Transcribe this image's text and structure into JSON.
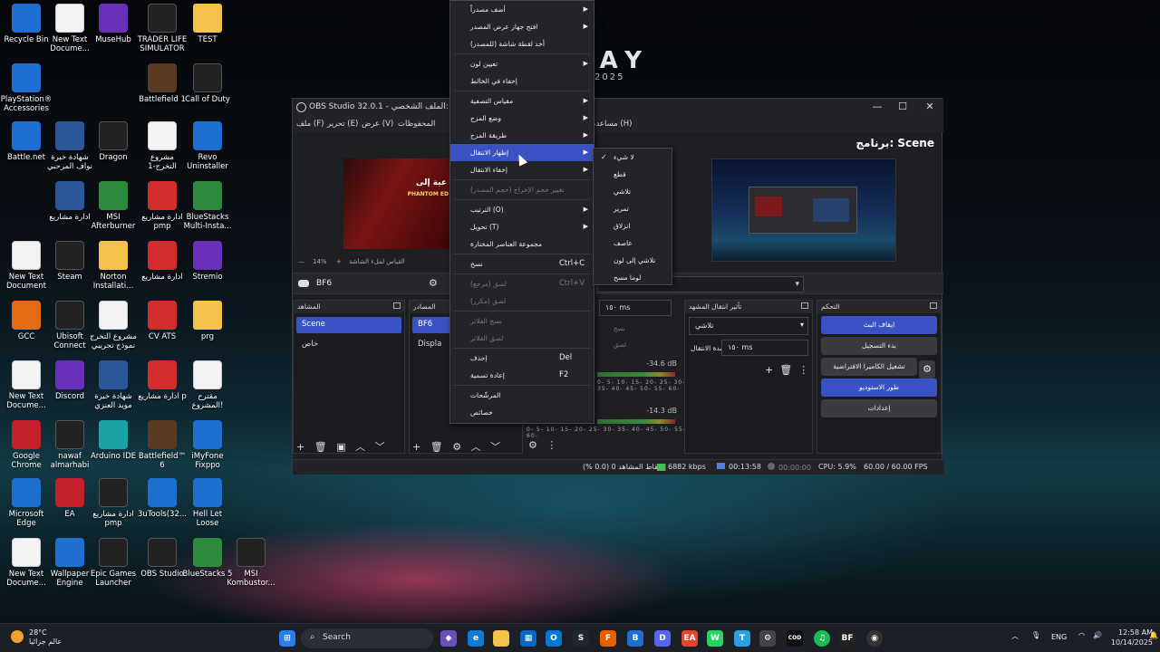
{
  "wallpaper": {
    "text": "DAY",
    "year": "2025"
  },
  "desktop_icons": [
    {
      "label": "Recycle Bin",
      "icon": "recycle-bin-icon"
    },
    {
      "label": "New Text Docume...",
      "icon": "text-doc-icon"
    },
    {
      "label": "MuseHub",
      "icon": "musehub-icon"
    },
    {
      "label": "TRADER LIFE SIMULATOR",
      "icon": "game-icon"
    },
    {
      "label": "TEST",
      "icon": "folder-icon"
    },
    {
      "label": "PlayStation® Accessories",
      "icon": "playstation-icon"
    },
    {
      "label": "Battlefield 1",
      "icon": "game-icon"
    },
    {
      "label": "Call of Duty",
      "icon": "cod-icon"
    },
    {
      "label": "Battle.net",
      "icon": "battlenet-icon"
    },
    {
      "label": "شهادة خبرة نواف المرحبي",
      "icon": "word-icon"
    },
    {
      "label": "Dragon",
      "icon": "dragon-icon"
    },
    {
      "label": "مشروع التخرج-1",
      "icon": "doc-icon"
    },
    {
      "label": "Revo Uninstaller",
      "icon": "revo-icon"
    },
    {
      "label": "ادارة مشاريع",
      "icon": "word-icon"
    },
    {
      "label": "MSI Afterburner",
      "icon": "msi-icon"
    },
    {
      "label": "ادارة مشاريع pmp",
      "icon": "pdf-icon"
    },
    {
      "label": "BlueStacks Multi-Insta...",
      "icon": "bluestacks-icon"
    },
    {
      "label": "New Text Document",
      "icon": "text-doc-icon"
    },
    {
      "label": "Steam",
      "icon": "steam-icon"
    },
    {
      "label": "Norton Installati...",
      "icon": "folder-icon"
    },
    {
      "label": "ادارة مشاريع",
      "icon": "pdf-icon"
    },
    {
      "label": "Stremio",
      "icon": "stremio-icon"
    },
    {
      "label": "GCC",
      "icon": "gcc-icon"
    },
    {
      "label": "Ubisoft Connect",
      "icon": "ubisoft-icon"
    },
    {
      "label": "مشروع التخرج نموذج تجريبي",
      "icon": "doc-icon"
    },
    {
      "label": "CV ATS",
      "icon": "pdf-icon"
    },
    {
      "label": "prg",
      "icon": "folder-icon"
    },
    {
      "label": "New Text Docume...",
      "icon": "text-doc-icon"
    },
    {
      "label": "Discord",
      "icon": "discord-icon"
    },
    {
      "label": "شهادة خبرة مويد العنزي",
      "icon": "word-icon"
    },
    {
      "label": "ادارة مشاريع p",
      "icon": "pdf-icon"
    },
    {
      "label": "مقترح المشروع!",
      "icon": "doc-icon"
    },
    {
      "label": "Google Chrome",
      "icon": "chrome-icon"
    },
    {
      "label": "nawaf almarhabi",
      "icon": "image-icon"
    },
    {
      "label": "Arduino IDE",
      "icon": "arduino-icon"
    },
    {
      "label": "Battlefield™ 6",
      "icon": "game-icon"
    },
    {
      "label": "iMyFone Fixppo",
      "icon": "imyfone-icon"
    },
    {
      "label": "Microsoft Edge",
      "icon": "edge-icon"
    },
    {
      "label": "EA",
      "icon": "ea-icon"
    },
    {
      "label": "ادارة مشاريع pmp",
      "icon": "image-icon"
    },
    {
      "label": "3uTools(32...",
      "icon": "3utools-icon"
    },
    {
      "label": "Hell Let Loose",
      "icon": "hll-icon"
    },
    {
      "label": "New Text Docume...",
      "icon": "text-doc-icon"
    },
    {
      "label": "Wallpaper Engine",
      "icon": "wallpaper-engine-icon"
    },
    {
      "label": "Epic Games Launcher",
      "icon": "epic-icon"
    },
    {
      "label": "OBS Studio",
      "icon": "obs-icon"
    },
    {
      "label": "BlueStacks 5",
      "icon": "bluestacks-icon"
    },
    {
      "label": "MSI Kombustor...",
      "icon": "kombustor-icon"
    }
  ],
  "obs": {
    "title": "OBS Studio 32.0.1 - الملف الشخصي: Untitled",
    "menu": [
      "ملف (F)",
      "تحرير (E)",
      "عرض (V)",
      "المحفوظات",
      "مساعدة (H)"
    ],
    "program_label": "برنامج: Scene",
    "source_bar_name": "BF6",
    "zoom": "14%",
    "zoom_hint": "القياس لملء الشاشة",
    "docks": {
      "scenes": {
        "title": "المشاهد",
        "items": [
          "Scene",
          "خاص"
        ]
      },
      "sources": {
        "title": "المصادر",
        "items": [
          "BF6",
          "Displa"
        ]
      },
      "transitions": {
        "title": "تأثير انتقال المشهد",
        "type": "تلاشي",
        "duration_label": "مدة الانتقال",
        "duration": "١٥٠ ms"
      },
      "controls": {
        "title": "التحكم",
        "buttons": [
          "ايقاف البث",
          "بدء التسجيل",
          "تشغيل الكاميرا الافتراضية",
          "طور الاستوديو",
          "إعدادات"
        ]
      }
    },
    "mixer": {
      "db1": "-34.6 dB",
      "db2": "-14.3 dB",
      "scale": "0- 5- 10- 15- 20- 25- 30- 35- 40- 45- 50- 55- 60-",
      "dur": "١٥٠ ms",
      "copy": "نسخ",
      "paste": "لصق"
    },
    "status": {
      "dropped": "إسقاط المشاهد 0 (0.0 %)",
      "bitrate": "6882 kbps",
      "stream_time": "00:13:58",
      "rec_time": "00:00:00",
      "cpu": "CPU: 5.9%",
      "fps": "60.00 / 60.00 FPS"
    }
  },
  "context_menu": {
    "items": [
      {
        "label": "أضف مصدراً",
        "submenu": true
      },
      {
        "label": "افتح جهاز عرض المصدر",
        "submenu": true
      },
      {
        "label": "أخذ لقطة شاشة (للمصدر)"
      },
      {
        "label": "تعيين لون",
        "submenu": true
      },
      {
        "label": "إخفاء في الخالط"
      },
      {
        "label": "مقياس التصفية",
        "submenu": true
      },
      {
        "label": "وضع المزج",
        "submenu": true
      },
      {
        "label": "طريقة المزج",
        "submenu": true
      },
      {
        "label": "إظهار الانتقال",
        "submenu": true,
        "highlight": true
      },
      {
        "label": "إخفاء الانتقال",
        "submenu": true
      },
      {
        "label": "تغيير حجم الإخراج (حجم المصدر)",
        "disabled": true
      },
      {
        "label": "الترتيب (O)",
        "submenu": true
      },
      {
        "label": "تحويل (T)",
        "submenu": true
      },
      {
        "label": "مجموعة العناصر المختارة"
      },
      {
        "label": "نسخ",
        "shortcut": "Ctrl+C"
      },
      {
        "label": "لصق (مرجع)",
        "shortcut": "Ctrl+V",
        "disabled": true
      },
      {
        "label": "لصق (مكرر)",
        "disabled": true
      },
      {
        "label": "نسخ الفلاتر",
        "disabled": true
      },
      {
        "label": "لصق الفلاتر",
        "disabled": true
      },
      {
        "label": "إحذف",
        "shortcut": "Del"
      },
      {
        "label": "إعادة تسمية",
        "shortcut": "F2"
      },
      {
        "label": "المرشّحات"
      },
      {
        "label": "خصائص"
      }
    ]
  },
  "submenu": {
    "items": [
      {
        "label": "لا شيء",
        "checked": true
      },
      {
        "label": "قطع"
      },
      {
        "label": "تلاشي"
      },
      {
        "label": "تمرير"
      },
      {
        "label": "انزلاق"
      },
      {
        "label": "عاصف"
      },
      {
        "label": "تلاشي إلى لون"
      },
      {
        "label": "لوما مسح"
      }
    ]
  },
  "taskbar": {
    "weather_temp": "28°C",
    "weather_desc": "عالم جزائيا",
    "search": "Search",
    "lang": "ENG",
    "time": "12:58 AM",
    "date": "10/14/2025"
  },
  "colors": {
    "accent": "#3b52c4",
    "panel": "#1e1f23",
    "taskbar": "#1c1f26"
  }
}
